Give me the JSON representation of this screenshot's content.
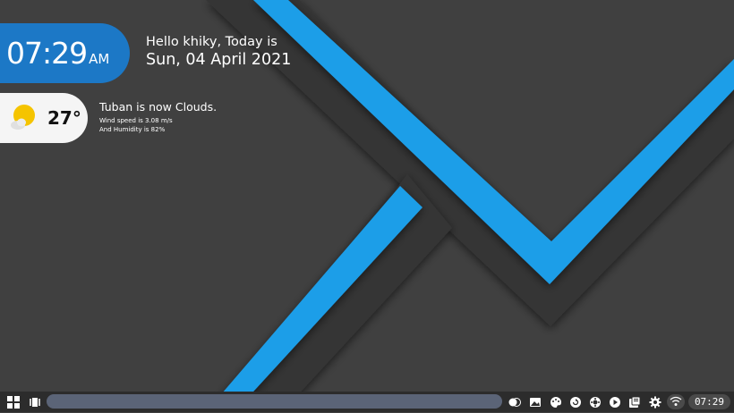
{
  "clock": {
    "time": "07:29",
    "ampm": "AM"
  },
  "greeting": {
    "line1": "Hello khiky, Today is",
    "line2": "Sun, 04 April 2021"
  },
  "weather": {
    "temperature": "27°",
    "status": "Tuban is now Clouds.",
    "wind": "Wind speed is 3.08 m/s",
    "humidity": "And Humidity is 82%",
    "icon": "partly-cloudy-icon"
  },
  "taskbar": {
    "clock": "07:29",
    "left_icons": [
      "start-menu-icon",
      "window-switcher-icon"
    ],
    "tray_icons": [
      "toggle-icon",
      "image-icon",
      "palette-icon",
      "refresh-icon",
      "settings-wheel-icon",
      "play-icon",
      "files-icon",
      "gear-icon",
      "wifi-icon"
    ]
  },
  "colors": {
    "accent": "#1c78c6",
    "stripe": "#1e9ee8",
    "background": "#404040",
    "taskbar": "#2c2c2c",
    "search_bar": "#5b6477"
  }
}
